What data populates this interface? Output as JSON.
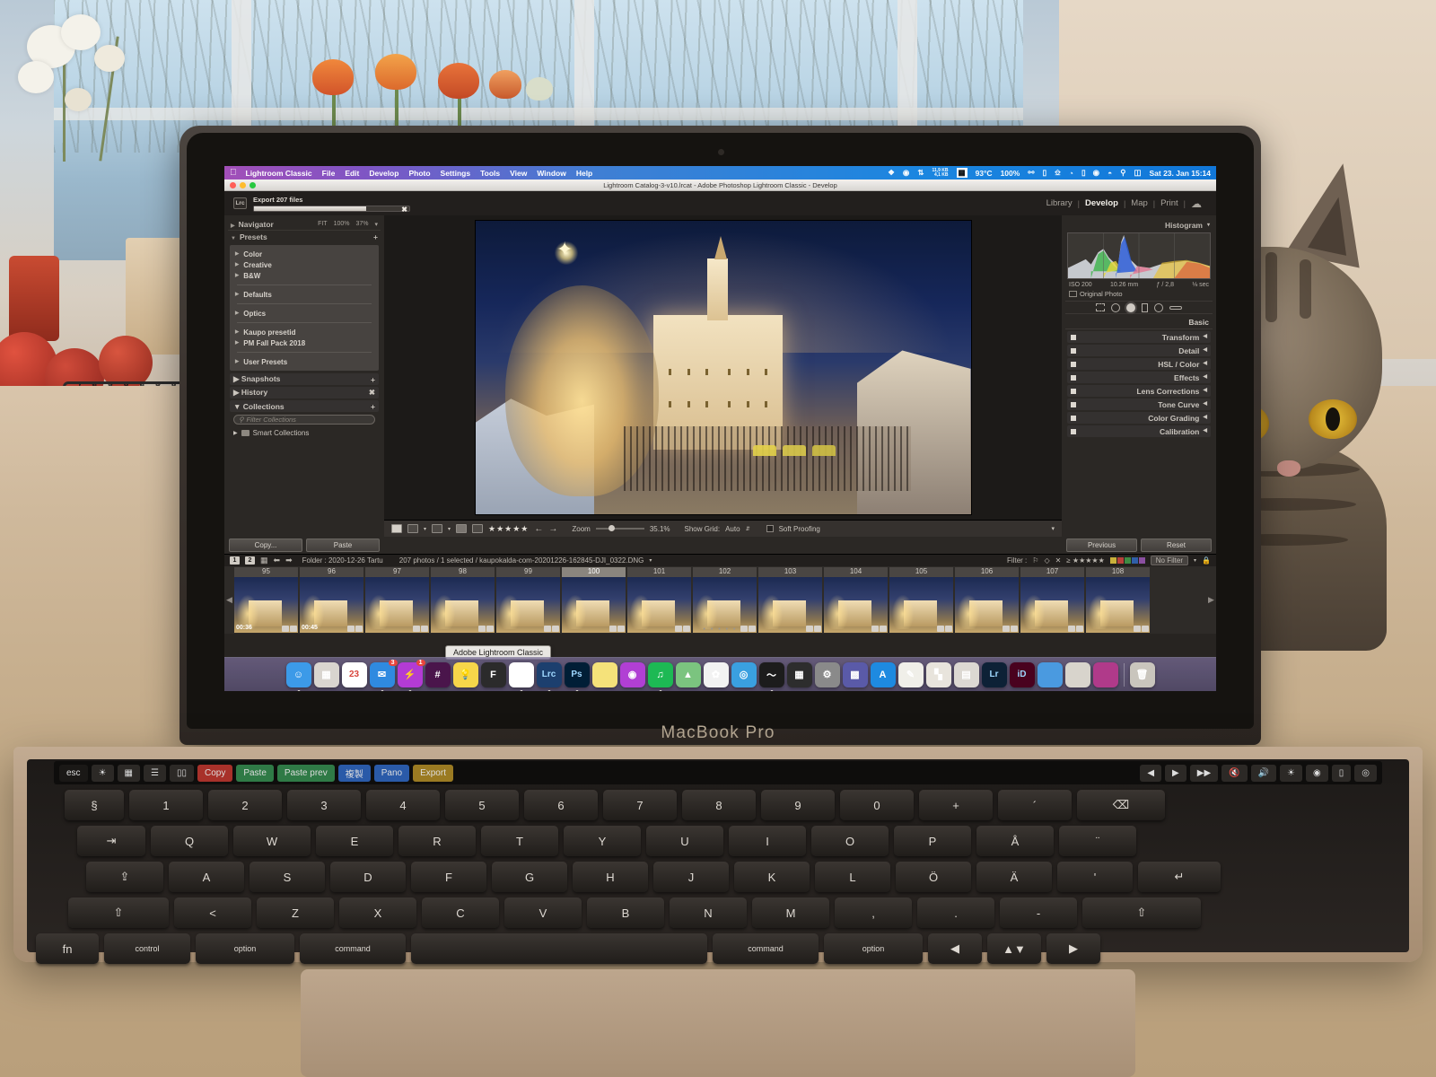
{
  "macos_menubar": {
    "apple_icon": "apple-icon",
    "app_name": "Lightroom Classic",
    "menus": [
      "File",
      "Edit",
      "Develop",
      "Photo",
      "Settings",
      "Tools",
      "View",
      "Window",
      "Help"
    ],
    "status": {
      "network_up": "11,9 KB",
      "network_down": "4,1 KB",
      "cpu_temp": "93°C",
      "battery_pct": "100%",
      "clock": "Sat 23. Jan  15:14",
      "icons": [
        "dropbox-icon",
        "eye-icon",
        "link-icon",
        "network-stats-icon",
        "cpu-graph-icon",
        "bluetooth-icon",
        "airplay-icon",
        "keyboard-icon",
        "timemachine-icon",
        "battery-icon",
        "controlcenter-icon",
        "wifi-icon",
        "search-icon",
        "notification-icon"
      ]
    }
  },
  "window": {
    "title": "Lightroom Catalog-3-v10.lrcat - Adobe Photoshop Lightroom Classic - Develop",
    "title_icon": "lightroom-doc-icon",
    "traffic_lights": [
      "#ff5f57",
      "#febc2e",
      "#28c840"
    ]
  },
  "identity": {
    "badge": "Lrc",
    "export_label": "Export 207 files",
    "export_progress_pct": 72,
    "cancel_icon": "close-icon"
  },
  "modules": {
    "items": [
      "Library",
      "Develop",
      "Map",
      "Print"
    ],
    "active": "Develop",
    "cloud_icon": "cloud-icon",
    "separator": "|"
  },
  "left_panel": {
    "navigator": {
      "title": "Navigator",
      "fit": "FIT",
      "hundred": "100%",
      "custom": "37%",
      "chevron_icon": "chevron-down-icon"
    },
    "presets": {
      "title": "Presets",
      "add_icon": "plus-icon",
      "groups_a": [
        "Color",
        "Creative",
        "B&W"
      ],
      "groups_b": [
        "Defaults"
      ],
      "groups_c": [
        "Optics"
      ],
      "groups_d": [
        "Kaupo presetid",
        "PM Fall Pack 2018"
      ],
      "groups_e": [
        "User Presets"
      ]
    },
    "snapshots": {
      "title": "Snapshots",
      "add_icon": "plus-icon"
    },
    "history": {
      "title": "History",
      "clear_icon": "close-icon"
    },
    "collections": {
      "title": "Collections",
      "add_icon": "plus-icon",
      "filter_placeholder": "Filter Collections",
      "search_icon": "search-icon",
      "items": [
        {
          "label": "Smart Collections",
          "icon": "smart-collection-icon"
        }
      ]
    },
    "buttons": {
      "copy": "Copy...",
      "paste": "Paste"
    }
  },
  "right_panel": {
    "histogram": {
      "title": "Histogram",
      "chevron_icon": "chevron-down-icon",
      "iso": "ISO 200",
      "focal_length": "10.26 mm",
      "aperture": "ƒ / 2,8",
      "shutter": "⅛ sec",
      "original_label": "Original Photo",
      "original_icon": "photo-icon"
    },
    "tools": [
      "crop-icon",
      "spot-removal-icon",
      "red-eye-icon",
      "masking-icon",
      "radial-icon",
      "gradient-icon"
    ],
    "sections": [
      "Basic",
      "Transform",
      "Detail",
      "HSL / Color",
      "Effects",
      "Lens Corrections",
      "Tone Curve",
      "Color Grading",
      "Calibration"
    ],
    "buttons": {
      "previous": "Previous",
      "reset": "Reset"
    }
  },
  "toolbar": {
    "view_icons": [
      "loupe-view-icon",
      "compare-view-icon",
      "before-after-icon"
    ],
    "flag_icons": [
      "pick-flag-icon",
      "reject-flag-icon"
    ],
    "rating": "★★★★★",
    "nav_icons": [
      "arrow-left-icon",
      "arrow-right-icon"
    ],
    "zoom_label": "Zoom",
    "zoom_value": "35.1%",
    "grid_label": "Show Grid:",
    "grid_value": "Auto",
    "grid_chevron": "chevron-updown-icon",
    "soft_proofing": "Soft Proofing",
    "collapse_icon": "chevron-down-icon"
  },
  "filmstrip_bar": {
    "screen_1": "1",
    "screen_2": "2",
    "grid_icon": "grid-view-icon",
    "back_icon": "arrow-left-icon",
    "forward_icon": "arrow-right-icon",
    "folder": "Folder : 2020-12-26 Tartu",
    "selection": "207 photos / 1 selected / kaupokalda-com-20201226-162845-DJI_0322.DNG",
    "dropdown_icon": "chevron-down-icon",
    "filter_label": "Filter :",
    "filter_flags": [
      "pick-flag-icon",
      "reject-flag-icon",
      "unflag-icon"
    ],
    "filter_stars": "≥ ★★★★★",
    "color_labels": [
      "#c9b03a",
      "#b8413a",
      "#3f8b44",
      "#2f5ea8",
      "#8a4fa0"
    ],
    "no_filter": "No Filter",
    "no_filter_chevron": "chevron-down-icon",
    "lock_icon": "lock-icon"
  },
  "filmstrip": {
    "prev_icon": "chevron-left-icon",
    "next_icon": "chevron-right-icon",
    "selected_index": 100,
    "cells": [
      {
        "num": "95",
        "duration": "00:36"
      },
      {
        "num": "96",
        "duration": "00:45"
      },
      {
        "num": "97",
        "duration": "",
        "flag": "flag-icon"
      },
      {
        "num": "98",
        "duration": ""
      },
      {
        "num": "99",
        "duration": ""
      },
      {
        "num": "100",
        "duration": ""
      },
      {
        "num": "101",
        "duration": ""
      },
      {
        "num": "102",
        "duration": ""
      },
      {
        "num": "103",
        "duration": ""
      },
      {
        "num": "104",
        "duration": ""
      },
      {
        "num": "105",
        "duration": ""
      },
      {
        "num": "106",
        "duration": ""
      },
      {
        "num": "107",
        "duration": ""
      },
      {
        "num": "108",
        "duration": ""
      }
    ]
  },
  "tooltip": {
    "text": "Adobe Lightroom Classic"
  },
  "dock": {
    "items": [
      {
        "name": "finder",
        "label": "",
        "color": "#3c9ae8",
        "glyph": "☺",
        "running": true
      },
      {
        "name": "launchpad",
        "label": "",
        "color": "#d9d5cf",
        "glyph": "▦",
        "running": false
      },
      {
        "name": "calendar",
        "label": "23",
        "color": "#ffffff",
        "glyph": "",
        "running": false
      },
      {
        "name": "mail",
        "label": "",
        "color": "#2f8ae0",
        "glyph": "✉",
        "running": true,
        "badge": "3"
      },
      {
        "name": "messenger",
        "label": "",
        "color": "#b33bd4",
        "glyph": "⚡",
        "running": true,
        "badge": "1"
      },
      {
        "name": "slack",
        "label": "",
        "color": "#4a154b",
        "glyph": "#",
        "running": false
      },
      {
        "name": "notes",
        "label": "",
        "color": "#f6d64a",
        "glyph": "💡",
        "running": false
      },
      {
        "name": "figma",
        "label": "",
        "color": "#2b2b2b",
        "glyph": "F",
        "running": false
      },
      {
        "name": "chrome",
        "label": "",
        "color": "#ffffff",
        "glyph": "◉",
        "running": true
      },
      {
        "name": "lightroom-classic",
        "label": "Lrc",
        "color": "#1c3f6e",
        "glyph": "",
        "running": true
      },
      {
        "name": "photoshop",
        "label": "Ps",
        "color": "#001e36",
        "glyph": "",
        "running": true
      },
      {
        "name": "stickies",
        "label": "",
        "color": "#f5e27a",
        "glyph": "",
        "running": false
      },
      {
        "name": "podcasts",
        "label": "",
        "color": "#b13fd4",
        "glyph": "◉",
        "running": false
      },
      {
        "name": "spotify",
        "label": "",
        "color": "#1db954",
        "glyph": "♫",
        "running": true
      },
      {
        "name": "maps",
        "label": "",
        "color": "#7bc47f",
        "glyph": "▲",
        "running": false
      },
      {
        "name": "photos",
        "label": "",
        "color": "#f2f2f2",
        "glyph": "✿",
        "running": false
      },
      {
        "name": "safari",
        "label": "",
        "color": "#3aa0e0",
        "glyph": "◎",
        "running": false
      },
      {
        "name": "activity-monitor",
        "label": "",
        "color": "#1c1c1c",
        "glyph": "〜",
        "running": true
      },
      {
        "name": "numbers",
        "label": "",
        "color": "#2d2d2d",
        "glyph": "▦",
        "running": false
      },
      {
        "name": "system-preferences",
        "label": "",
        "color": "#8a8a8a",
        "glyph": "⚙",
        "running": false
      },
      {
        "name": "apps-folder",
        "label": "",
        "color": "#5a5aa8",
        "glyph": "▩",
        "running": false
      },
      {
        "name": "app-store",
        "label": "",
        "color": "#1e8ae0",
        "glyph": "A",
        "running": false
      },
      {
        "name": "textedit",
        "label": "",
        "color": "#f0efe9",
        "glyph": "✎",
        "running": false
      },
      {
        "name": "chess",
        "label": "",
        "color": "#e8e4dc",
        "glyph": "▚",
        "running": false
      },
      {
        "name": "preview",
        "label": "",
        "color": "#dcd8d2",
        "glyph": "▤",
        "running": false
      },
      {
        "name": "lightroom-cc",
        "label": "Lr",
        "color": "#0d2136",
        "glyph": "",
        "running": false
      },
      {
        "name": "indesign",
        "label": "iD",
        "color": "#49021f",
        "glyph": "",
        "running": false
      },
      {
        "name": "downloads-folder",
        "label": "",
        "color": "#4a9ae0",
        "glyph": "",
        "running": false
      },
      {
        "name": "documents-folder",
        "label": "",
        "color": "#d8d4cc",
        "glyph": "",
        "running": false
      },
      {
        "name": "screenshot-stack",
        "label": "",
        "color": "#b03a8a",
        "glyph": "",
        "running": false
      },
      {
        "name": "trash",
        "label": "",
        "color": "#c9c5bd",
        "glyph": "🗑",
        "running": false
      }
    ]
  },
  "touchbar": {
    "esc": "esc",
    "keys": [
      {
        "label": "Copy",
        "style": "red"
      },
      {
        "label": "Paste",
        "style": "green"
      },
      {
        "label": "Paste prev",
        "style": "green"
      },
      {
        "label": "複製",
        "style": "blue"
      },
      {
        "label": "Pano",
        "style": "blue"
      },
      {
        "label": "Export",
        "style": "gold"
      }
    ]
  },
  "laptop": {
    "brand": "MacBook Pro"
  },
  "keyboard": {
    "row_numbers": [
      "§",
      "1",
      "2",
      "3",
      "4",
      "5",
      "6",
      "7",
      "8",
      "9",
      "0",
      "+",
      "´",
      "⌫"
    ],
    "row_q": [
      "⇥",
      "Q",
      "W",
      "E",
      "R",
      "T",
      "Y",
      "U",
      "I",
      "O",
      "P",
      "Å",
      "¨"
    ],
    "row_a": [
      "⇪",
      "A",
      "S",
      "D",
      "F",
      "G",
      "H",
      "J",
      "K",
      "L",
      "Ö",
      "Ä",
      "'",
      "↵"
    ],
    "row_z": [
      "⇧",
      "<",
      "Z",
      "X",
      "C",
      "V",
      "B",
      "N",
      "M",
      ",",
      ".",
      "-",
      "⇧"
    ],
    "row_mod": [
      "fn",
      "control",
      "option",
      "command",
      "",
      "command",
      "option",
      "◀",
      "▲▼",
      "▶"
    ]
  }
}
